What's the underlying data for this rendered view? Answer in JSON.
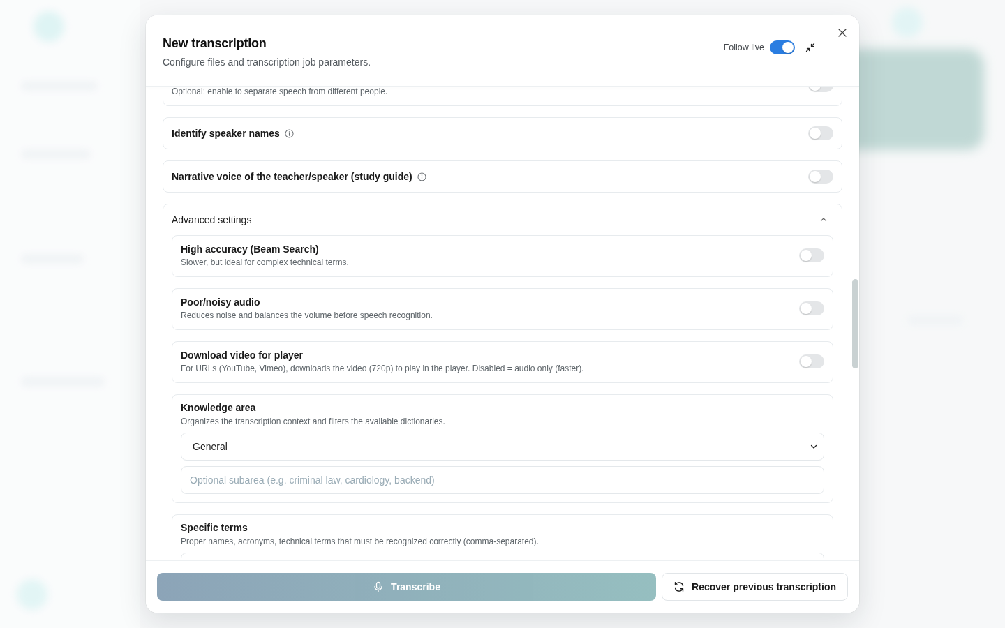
{
  "dialog": {
    "title": "New transcription",
    "subtitle": "Configure files and transcription job parameters.",
    "follow_live": {
      "label": "Follow live",
      "on": true
    }
  },
  "options": [
    {
      "description": "Optional: enable to separate speech from different people.",
      "on": false
    },
    {
      "label": "Identify speaker names",
      "info": true,
      "on": false
    },
    {
      "label": "Narrative voice of the teacher/speaker (study guide)",
      "info": true,
      "on": false
    }
  ],
  "advanced": {
    "title": "Advanced settings",
    "expanded": true,
    "items": [
      {
        "kind": "toggle",
        "label": "High accuracy (Beam Search)",
        "description": "Slower, but ideal for complex technical terms.",
        "on": false
      },
      {
        "kind": "toggle",
        "label": "Poor/noisy audio",
        "description": "Reduces noise and balances the volume before speech recognition.",
        "on": false
      },
      {
        "kind": "toggle",
        "label": "Download video for player",
        "description": "For URLs (YouTube, Vimeo), downloads the video (720p) to play in the player. Disabled = audio only (faster).",
        "on": false
      },
      {
        "kind": "select",
        "label": "Knowledge area",
        "description": "Organizes the transcription context and filters the available dictionaries.",
        "value": "General",
        "placeholder": "Optional subarea (e.g. criminal law, cardiology, backend)"
      },
      {
        "kind": "text",
        "label": "Specific terms",
        "description": "Proper names, acronyms, technical terms that must be recognized correctly (comma-separated)."
      }
    ]
  },
  "actions": [
    {
      "kind": "primary",
      "label": "Transcribe",
      "disabled": true
    },
    {
      "kind": "secondary",
      "label": "Recover previous transcription"
    }
  ]
}
